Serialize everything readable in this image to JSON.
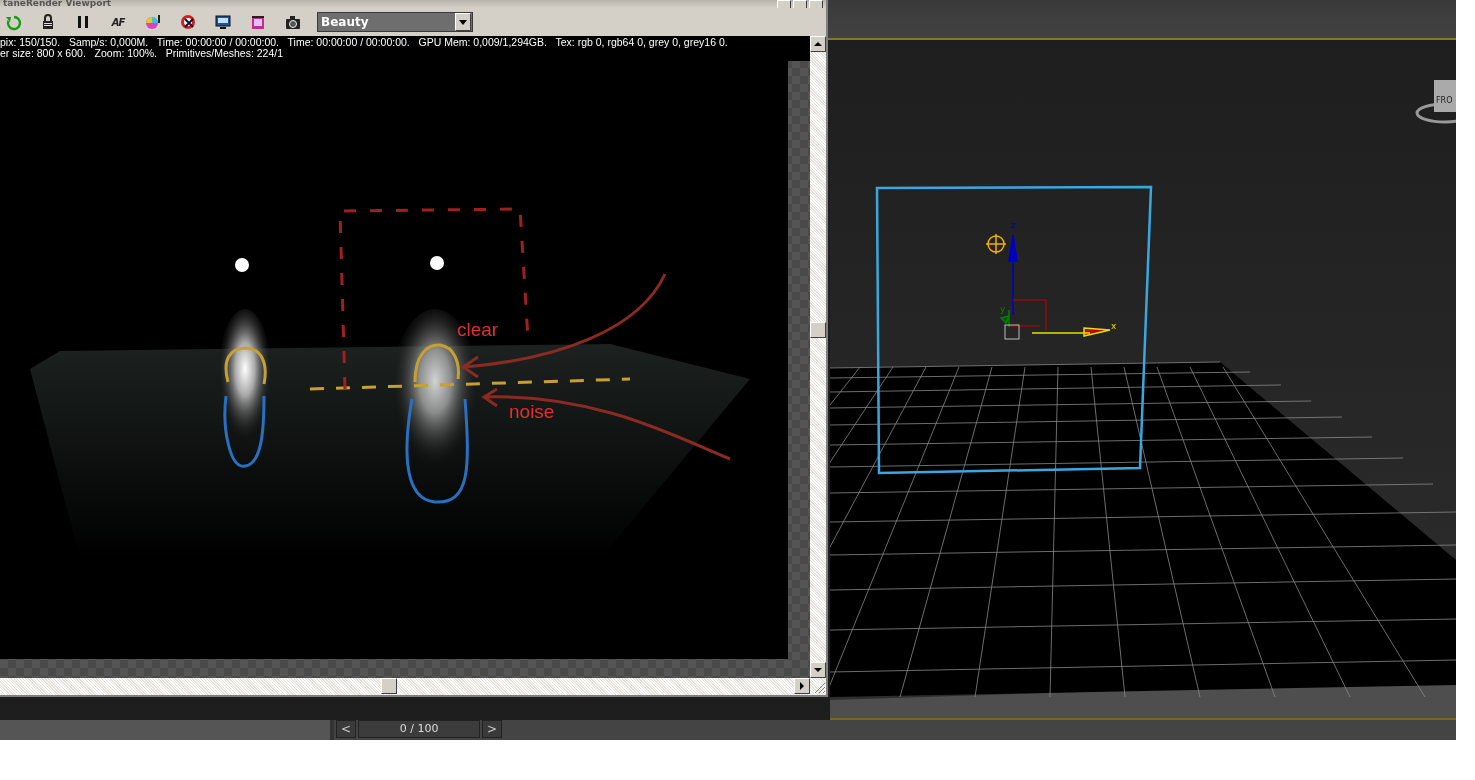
{
  "render_window": {
    "title": "taneRender Viewport",
    "toolbar": [
      {
        "kind": "refresh"
      },
      {
        "kind": "lock"
      },
      {
        "kind": "pause"
      },
      {
        "kind": "focus",
        "label": "AF"
      },
      {
        "kind": "color"
      },
      {
        "kind": "clear"
      },
      {
        "kind": "monitor"
      },
      {
        "kind": "film"
      },
      {
        "kind": "camera"
      }
    ],
    "pass_dropdown": {
      "value": "Beauty"
    },
    "stats": [
      "pix: 150/150.   Samp/s: 0,000M.   Time: 00:00:00 / 00:00:00.   Time: 00:00:00 / 00:00:00.   GPU Mem: 0,009/1,294GB.   Tex: rgb 0, rgb64 0, grey 0, grey16 0.",
      "er size: 800 x 600.   Zoom: 100%.   Primitives/Meshes: 224/1"
    ],
    "annotations": [
      {
        "text": "clear"
      },
      {
        "text": "noise"
      }
    ]
  },
  "scene_viewport": {
    "viewcube_label": "FRO",
    "axis_labels": [
      {
        "text": "z"
      },
      {
        "text": "y"
      },
      {
        "text": "x"
      }
    ]
  },
  "time_slider": {
    "prev": "<",
    "frame": "0 / 100",
    "next": ">"
  }
}
